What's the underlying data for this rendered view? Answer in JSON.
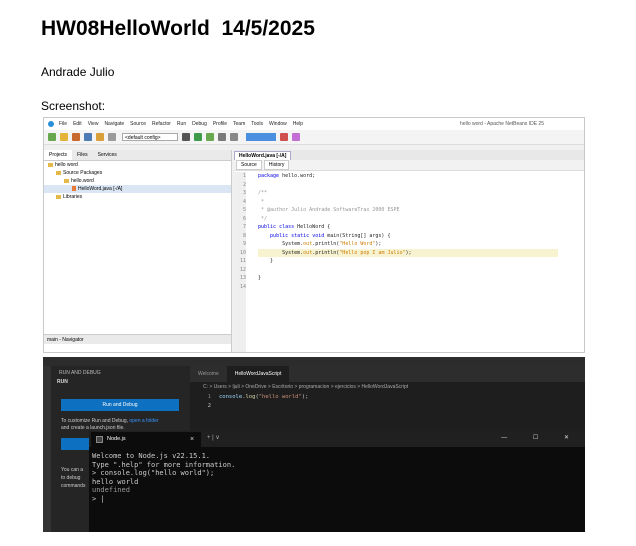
{
  "document": {
    "title": "HW08HelloWorld  14/5/2025",
    "author": "Andrade Julio",
    "screenshot_label": "Screenshot:"
  },
  "netbeans": {
    "window_title": "hello word - Apache NetBeans IDE 25",
    "menus": [
      "File",
      "Edit",
      "View",
      "Navigate",
      "Source",
      "Refactor",
      "Run",
      "Debug",
      "Profile",
      "Team",
      "Tools",
      "Window",
      "Help"
    ],
    "config_combo": "<default config>",
    "panel_tabs": [
      "Projects",
      "Files",
      "Services"
    ],
    "tree": [
      "hello word",
      "Source Packages",
      "hello.word",
      "HelloWord.java [-/A]",
      "Libraries"
    ],
    "navigator_label": "main - Navigator",
    "editor_tab": "HelloWord.java [-/A]",
    "editor_modes": [
      "Source",
      "History"
    ],
    "line_numbers": [
      "1",
      "2",
      "3",
      "4",
      "5",
      "6",
      "7",
      "8",
      "9",
      "10",
      "11",
      "12",
      "13",
      "14"
    ],
    "code": {
      "l1_kw": "package",
      "l1_rest": " hello.word;",
      "l3": "/**",
      "l4": " *",
      "l5": " * @author Julio Andrade SoftwareTrax 2000 ESPE",
      "l6": " */",
      "l7_kw": "public class",
      "l7_rest": " HelloWord {",
      "l8_kw": "public static void",
      "l8_rest": " main(String[] args) {",
      "l9_a": "System.",
      "l9_b": "out",
      "l9_c": ".println(",
      "l9_str": "\"Hello Word\"",
      "l9_end": ");",
      "l10_a": "System.",
      "l10_b": "out",
      "l10_c": ".println(",
      "l10_str": "\"Hello pop I am Julio\"",
      "l10_end": ");",
      "l11": "}",
      "l13": "}"
    }
  },
  "vscode": {
    "side_header": "RUN AND DEBUG",
    "side_section": "RUN",
    "run_button": "Run and Debug",
    "side_text_a": "To customize Run and Debug,",
    "side_link": "open a folder",
    "side_text_b": "and create a launch.json file.",
    "side_text_c": "You can a",
    "side_text_d": "to debug",
    "side_text_e": "commands",
    "tabs": [
      "Welcome",
      "HelloWordJavaScript"
    ],
    "breadcrumb": "C: > Users > ljuli > OneDrive > Escritorio > programacion > ejercicios > HelloWordJavaScript",
    "code_lines": [
      {
        "ln": "1",
        "fn": "console",
        "mid": ".",
        "call": "log",
        "open": "(",
        "str": "\"hello world\"",
        "close": ");"
      },
      {
        "ln": "2",
        "fn": "",
        "mid": "",
        "call": "",
        "open": "",
        "str": "",
        "close": ""
      }
    ]
  },
  "terminal": {
    "tab_title": "Node.js",
    "close_glyph": "×",
    "extra": "+  |  ∨",
    "controls": "—  ☐  ✕",
    "lines": [
      "Welcome to Node.js v22.15.1.",
      "Type \".help\" for more information.",
      "> console.log(\"hello world\");",
      "hello world",
      "undefined",
      "> |"
    ]
  },
  "colors": {
    "vs_blue_button": "#0e70c0",
    "terminal_bg": "#0c0c0c",
    "netbeans_keyword": "#0000e6",
    "netbeans_string": "#ce7b00"
  }
}
